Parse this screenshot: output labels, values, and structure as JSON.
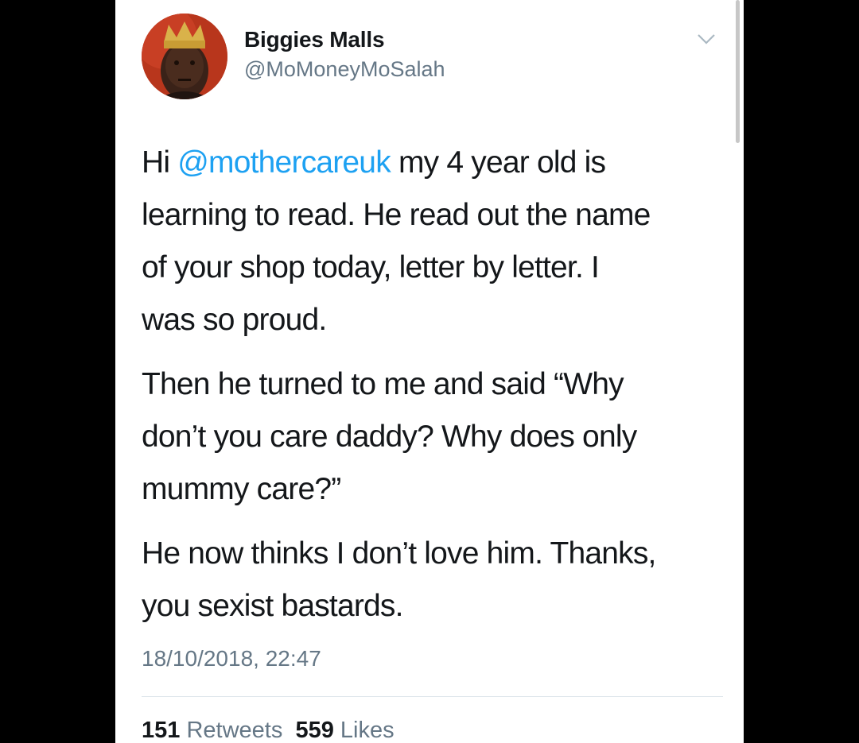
{
  "tweet": {
    "author": {
      "display_name": "Biggies Malls",
      "handle": "@MoMoneyMoSalah"
    },
    "menu_icon": "chevron-down-icon",
    "text": {
      "p1_before": "Hi ",
      "p1_mention": "@mothercareuk",
      "p1_line1_rest": " my 4 year old is",
      "p1_line2": "learning to read. He read out the name",
      "p1_line3": "of your shop today, letter by letter. I",
      "p1_line4": "was so proud.",
      "p2_line1": "Then he turned to me and said “Why",
      "p2_line2": "don’t you care daddy? Why does only",
      "p2_line3": "mummy care?”",
      "p3_line1": "He now thinks I don’t love him. Thanks,",
      "p3_line2": "you sexist bastards."
    },
    "timestamp": "18/10/2018, 22:47",
    "stats": {
      "retweets_count": "151",
      "retweets_label": "Retweets",
      "likes_count": "559",
      "likes_label": "Likes"
    }
  },
  "colors": {
    "mention": "#1da1f2",
    "secondary_text": "#657786",
    "primary_text": "#14171a"
  }
}
